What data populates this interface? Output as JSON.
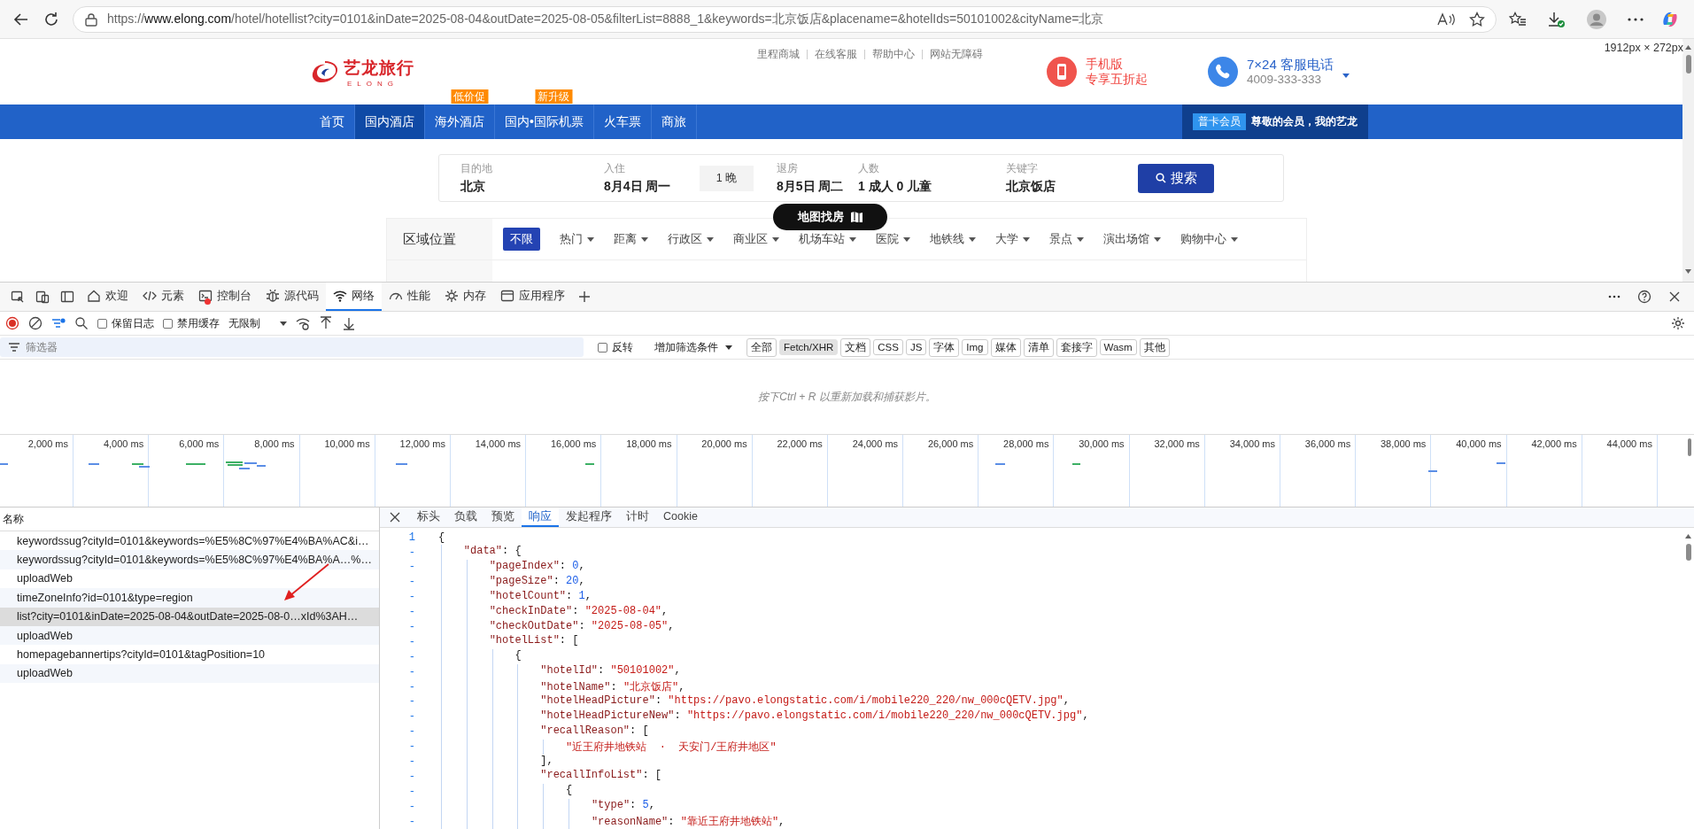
{
  "browser": {
    "url_scheme": "https://",
    "url_host": "www.elong.com",
    "url_path": "/hotel/hotellist?city=0101&inDate=2025-08-04&outDate=2025-08-05&filterList=8888_1&keywords=北京饭店&placename=&hotelIds=50101002&cityName=北京",
    "viewport_size": "1912px × 272px"
  },
  "site": {
    "logo_text": "艺龙旅行",
    "logo_subtext": "ELONG",
    "top_links": [
      "里程商城",
      "在线客服",
      "帮助中心",
      "网站无障碍"
    ],
    "mobile": {
      "title": "手机版",
      "subtitle": "专享五折起"
    },
    "hotline": {
      "title": "7×24 客服电话",
      "number": "4009-333-333"
    },
    "nav": [
      {
        "label": "首页",
        "selected": false
      },
      {
        "label": "国内酒店",
        "selected": true
      },
      {
        "label": "海外酒店",
        "selected": false,
        "badge": "低价促"
      },
      {
        "label": "国内•国际机票",
        "selected": false,
        "badge": "新升级"
      },
      {
        "label": "火车票",
        "selected": false
      },
      {
        "label": "商旅",
        "selected": false
      }
    ],
    "member": {
      "badge": "普卡会员",
      "greeting": "尊敬的会员，我的艺龙"
    },
    "search": {
      "fields": [
        {
          "kind": "field",
          "label": "目的地",
          "value": "北京"
        },
        {
          "kind": "field",
          "label": "入住",
          "value": "8月4日 周一"
        },
        {
          "kind": "chip",
          "value": "1 晚"
        },
        {
          "kind": "field",
          "label": "退房",
          "value": "8月5日 周二"
        },
        {
          "kind": "field",
          "label": "人数",
          "value": "1 成人 0 儿童"
        },
        {
          "kind": "field",
          "label": "关键字",
          "value": "北京饭店"
        }
      ],
      "button": "搜索"
    },
    "map_button": "地图找房",
    "filters": {
      "label": "区域位置",
      "options": [
        {
          "label": "不限",
          "selected": true,
          "dropdown": false
        },
        {
          "label": "热门",
          "selected": false,
          "dropdown": true
        },
        {
          "label": "距离",
          "selected": false,
          "dropdown": true
        },
        {
          "label": "行政区",
          "selected": false,
          "dropdown": true
        },
        {
          "label": "商业区",
          "selected": false,
          "dropdown": true
        },
        {
          "label": "机场车站",
          "selected": false,
          "dropdown": true
        },
        {
          "label": "医院",
          "selected": false,
          "dropdown": true
        },
        {
          "label": "地铁线",
          "selected": false,
          "dropdown": true
        },
        {
          "label": "大学",
          "selected": false,
          "dropdown": true
        },
        {
          "label": "景点",
          "selected": false,
          "dropdown": true
        },
        {
          "label": "演出场馆",
          "selected": false,
          "dropdown": true
        },
        {
          "label": "购物中心",
          "selected": false,
          "dropdown": true
        }
      ]
    }
  },
  "devtools": {
    "tabs": [
      {
        "label": "欢迎",
        "selected": false,
        "alert": false
      },
      {
        "label": "元素",
        "selected": false,
        "alert": false
      },
      {
        "label": "控制台",
        "selected": false,
        "alert": true
      },
      {
        "label": "源代码",
        "selected": false,
        "alert": false
      },
      {
        "label": "网络",
        "selected": true,
        "alert": false
      },
      {
        "label": "性能",
        "selected": false,
        "alert": false
      },
      {
        "label": "内存",
        "selected": false,
        "alert": false
      },
      {
        "label": "应用程序",
        "selected": false,
        "alert": false
      }
    ],
    "toolbar": {
      "preserve_log": {
        "label": "保留日志",
        "checked": false
      },
      "disable_cache": {
        "label": "禁用缓存",
        "checked": false
      },
      "throttling": "无限制"
    },
    "filter_bar": {
      "placeholder": "筛选器",
      "invert": {
        "label": "反转",
        "checked": false
      },
      "more_filters": "增加筛选条件",
      "types": [
        {
          "label": "全部",
          "selected": false
        },
        {
          "label": "Fetch/XHR",
          "selected": true
        },
        {
          "label": "文档",
          "selected": false
        },
        {
          "label": "CSS",
          "selected": false
        },
        {
          "label": "JS",
          "selected": false
        },
        {
          "label": "字体",
          "selected": false
        },
        {
          "label": "Img",
          "selected": false
        },
        {
          "label": "媒体",
          "selected": false
        },
        {
          "label": "清单",
          "selected": false
        },
        {
          "label": "套接字",
          "selected": false
        },
        {
          "label": "Wasm",
          "selected": false
        },
        {
          "label": "其他",
          "selected": false
        }
      ]
    },
    "empty_message": "按下Ctrl + R 以重新加载和捕获影片。",
    "timeline": {
      "ticks": [
        "2,000 ms",
        "4,000 ms",
        "6,000 ms",
        "8,000 ms",
        "10,000 ms",
        "12,000 ms",
        "14,000 ms",
        "16,000 ms",
        "18,000 ms",
        "20,000 ms",
        "22,000 ms",
        "24,000 ms",
        "26,000 ms",
        "28,000 ms",
        "30,000 ms",
        "32,000 ms",
        "34,000 ms",
        "36,000 ms",
        "38,000 ms",
        "40,000 ms",
        "42,000 ms",
        "44,000 ms"
      ]
    },
    "requests": {
      "header": "名称",
      "rows": [
        {
          "name": "keywordssug?cityId=0101&keywords=%E5%8C%97%E4%BA%AC&i…",
          "selected": false
        },
        {
          "name": "keywordssug?cityId=0101&keywords=%E5%8C%97%E4%BA%A…%…",
          "selected": false
        },
        {
          "name": "uploadWeb",
          "selected": false
        },
        {
          "name": "timeZoneInfo?id=0101&type=region",
          "selected": false
        },
        {
          "name": "list?city=0101&inDate=2025-08-04&outDate=2025-08-0…xId%3AH…",
          "selected": true
        },
        {
          "name": "uploadWeb",
          "selected": false
        },
        {
          "name": "homepagebannertips?cityId=0101&tagPosition=10",
          "selected": false
        },
        {
          "name": "uploadWeb",
          "selected": false
        }
      ]
    },
    "detail": {
      "tabs": [
        {
          "label": "标头",
          "selected": false
        },
        {
          "label": "负载",
          "selected": false
        },
        {
          "label": "预览",
          "selected": false
        },
        {
          "label": "响应",
          "selected": true
        },
        {
          "label": "发起程序",
          "selected": false
        },
        {
          "label": "计时",
          "selected": false
        },
        {
          "label": "Cookie",
          "selected": false
        }
      ],
      "lines": [
        {
          "gutter": "1",
          "code": "{"
        },
        {
          "gutter": "-",
          "code": "    \"data\": {"
        },
        {
          "gutter": "-",
          "code": "        \"pageIndex\": 0,"
        },
        {
          "gutter": "-",
          "code": "        \"pageSize\": 20,"
        },
        {
          "gutter": "-",
          "code": "        \"hotelCount\": 1,"
        },
        {
          "gutter": "-",
          "code": "        \"checkInDate\": \"2025-08-04\","
        },
        {
          "gutter": "-",
          "code": "        \"checkOutDate\": \"2025-08-05\","
        },
        {
          "gutter": "-",
          "code": "        \"hotelList\": ["
        },
        {
          "gutter": "-",
          "code": "            {"
        },
        {
          "gutter": "-",
          "code": "                \"hotelId\": \"50101002\","
        },
        {
          "gutter": "-",
          "code": "                \"hotelName\": \"北京饭店\","
        },
        {
          "gutter": "-",
          "code": "                \"hotelHeadPicture\": \"https://pavo.elongstatic.com/i/mobile220_220/nw_000cQETV.jpg\","
        },
        {
          "gutter": "-",
          "code": "                \"hotelHeadPictureNew\": \"https://pavo.elongstatic.com/i/mobile220_220/nw_000cQETV.jpg\","
        },
        {
          "gutter": "-",
          "code": "                \"recallReason\": ["
        },
        {
          "gutter": "-",
          "code": "                    \"近王府井地铁站  ·  天安门/王府井地区\""
        },
        {
          "gutter": "-",
          "code": "                ],"
        },
        {
          "gutter": "-",
          "code": "                \"recallInfoList\": ["
        },
        {
          "gutter": "-",
          "code": "                    {"
        },
        {
          "gutter": "-",
          "code": "                        \"type\": 5,"
        },
        {
          "gutter": "-",
          "code": "                        \"reasonName\": \"靠近王府井地铁站\","
        }
      ]
    }
  }
}
